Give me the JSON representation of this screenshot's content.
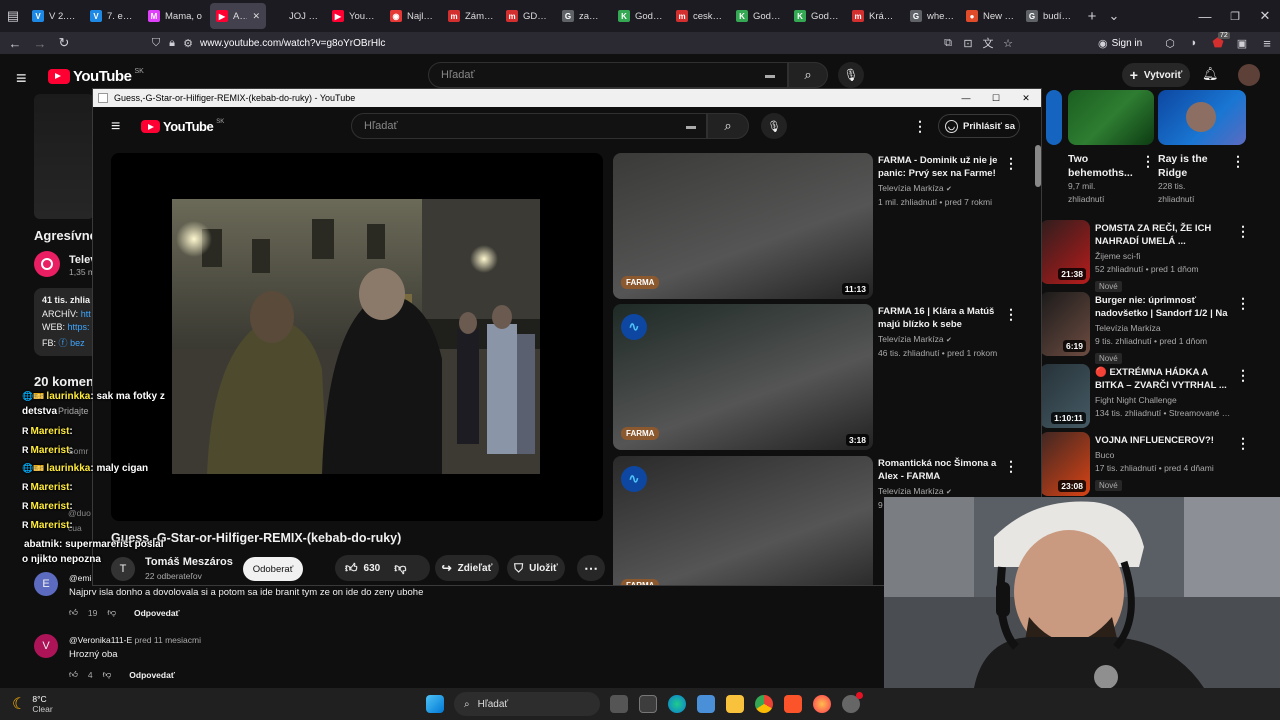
{
  "browser": {
    "tabs": [
      {
        "label": "V 2. epizó",
        "color": "#1e88e5",
        "glyph": "V"
      },
      {
        "label": "7. epizó",
        "color": "#1e88e5",
        "glyph": "V"
      },
      {
        "label": "Mama, o",
        "color": "#e040fb",
        "glyph": "M"
      },
      {
        "label": "Agres",
        "color": "#ff0033",
        "glyph": "▶",
        "active": true
      },
      {
        "label": "JOJ play",
        "color": "#1c1b22",
        "glyph": ""
      },
      {
        "label": "YouTube",
        "color": "#ff0033",
        "glyph": "▶"
      },
      {
        "label": "Najlepší",
        "color": "#e53935",
        "glyph": "◉"
      },
      {
        "label": "Zámena",
        "color": "#d32f2f",
        "glyph": "m"
      },
      {
        "label": "GDW6 -",
        "color": "#d32f2f",
        "glyph": "m"
      },
      {
        "label": "zamena",
        "color": "#5f6368",
        "glyph": "G"
      },
      {
        "label": "Godwin",
        "color": "#34a853",
        "glyph": "K"
      },
      {
        "label": "ceska re",
        "color": "#d32f2f",
        "glyph": "m"
      },
      {
        "label": "Godwin",
        "color": "#34a853",
        "glyph": "K"
      },
      {
        "label": "Godwin",
        "color": "#34a853",
        "glyph": "K"
      },
      {
        "label": "Krásne s",
        "color": "#d32f2f",
        "glyph": "m"
      },
      {
        "label": "where in",
        "color": "#5f6368",
        "glyph": "G"
      },
      {
        "label": "New Tab",
        "color": "#e04b2a",
        "glyph": "●"
      },
      {
        "label": "budík o",
        "color": "#5f6368",
        "glyph": "G"
      }
    ],
    "new_tab_glyph": "+",
    "url": "www.youtube.com/watch?v=g8oYrOBrHlc",
    "sign_in": "Sign in",
    "badge_count": "72"
  },
  "yt_bg": {
    "logo": "YouTube",
    "region": "SK",
    "search_placeholder": "Hľadať",
    "create": "Vytvoriť",
    "channel_title_partial": "Agresívne",
    "channel_name_partial": "Telev",
    "channel_subs_partial": "1,35 m",
    "desc_views_partial": "41 tis. zhlia",
    "desc_archiv": "ARCHÍV:",
    "desc_archiv_link": "htt",
    "desc_web": "WEB:",
    "desc_web_link": "https:",
    "desc_fb": "FB:",
    "desc_fb_link": "bez",
    "comments_heading_partial": "20 komen",
    "add_comment_partial": "Pridajte",
    "top_row": [
      {
        "title": "Two behemoths...",
        "meta1": "9,7 mil.",
        "meta2": "zhliadnutí"
      },
      {
        "title": "Ray is the Ridge",
        "meta1": "228 tis.",
        "meta2": "zhliadnutí"
      }
    ],
    "right_list": [
      {
        "title": "POMSTA ZA REČI, ŽE ICH NAHRADÍ UMELÁ ...",
        "channel": "Žijeme sci-fi",
        "meta": "52 zhliadnutí • pred 1 dňom",
        "badge": "Nové",
        "duration": "21:38"
      },
      {
        "title": "Burger nie: úprimnosť nadovšetko | Sandorf 1/2 | Na ...",
        "channel": "Televízia Markíza",
        "meta": "9 tis. zhliadnutí • pred 1 dňom",
        "badge": "Nové",
        "duration": "6:19"
      },
      {
        "title": "🔴 EXTRÉMNA HÁDKA A BITKA – ZVARČI VYTRHAL ...",
        "channel": "Fight Night Challenge",
        "meta": "134 tis. zhliadnutí • Streamované pred 4 ...",
        "badge": "",
        "duration": "1:10:11"
      },
      {
        "title": "VOJNA INFLUENCEROV?!",
        "channel": "Buco",
        "meta": "17 tis. zhliadnutí • pred 4 dňami",
        "badge": "Nové",
        "duration": "23:08"
      }
    ],
    "comments": [
      {
        "avatar": "E",
        "author": "@emi",
        "text": "Najprv isla donho a dovolovala si a potom sa ide branit tym ze on ide do zeny ubohe",
        "likes": "19",
        "reply": "Odpovedať",
        "avatar_color": "#5c6bc0"
      },
      {
        "avatar": "V",
        "author": "@Veronika111-E",
        "time": "pred 11 mesiacmi",
        "text": "Hrozný oba",
        "likes": "4",
        "reply": "Odpovedať",
        "avatar_color": "#ad1457"
      }
    ]
  },
  "popup": {
    "window_title": "Guess,-G-Star-or-Hilfiger-REMIX-(kebab-do-ruky) - YouTube",
    "logo": "YouTube",
    "region": "SK",
    "search_placeholder": "Hľadať",
    "sign_in": "Prihlásiť sa",
    "video_title": "Guess,-G-Star-or-Hilfiger-REMIX-(kebab-do-ruky)",
    "channel": "Tomáš Meszáros",
    "channel_initial": "T",
    "subscribers": "22 odberateľov",
    "subscribe": "Odoberať",
    "likes": "630",
    "share": "Zdieľať",
    "save": "Uložiť",
    "recommended": [
      {
        "title": "FARMA - Dominik už nie je panic: Prvý sex na Farme!",
        "channel": "Televízia Markíza",
        "meta": "1 mil. zhliadnutí • pred 7 rokmi",
        "duration": "11:13",
        "logo": "FARMA"
      },
      {
        "title": "FARMA 16 | Klára a Matúš majú blízko k sebe",
        "channel": "Televízia Markíza",
        "meta": "46 tis. zhliadnutí • pred 1 rokom",
        "duration": "3:18",
        "logo": "FARMA"
      },
      {
        "title": "Romantická noc Šimona a Alex - FARMA",
        "channel": "Televízia Markíza",
        "meta": "9",
        "duration": "",
        "logo": "FARMA"
      }
    ]
  },
  "chat": [
    {
      "user": "laurinkka",
      "text": ": sak ma fotky z detstva",
      "color": "#ffeb3b",
      "badges": "🌐🎫"
    },
    {
      "user": "Marerist",
      "text": ":",
      "color": "#ffeb3b",
      "badges": "R"
    },
    {
      "user": "Marerist",
      "text": ":",
      "color": "#ffeb3b",
      "badges": "R"
    },
    {
      "user": "laurinkka",
      "text": ": maly cigan",
      "color": "#ffeb3b",
      "badges": "🌐🎫"
    },
    {
      "user": "Marerist",
      "text": ":",
      "color": "#ffeb3b",
      "badges": "R"
    },
    {
      "user": "Marerist",
      "text": ":",
      "color": "#ffeb3b",
      "badges": "R"
    },
    {
      "user": "Marerist",
      "text": ":",
      "color": "#ffeb3b",
      "badges": "R"
    },
    {
      "user": "abatnik",
      "text": ": supermarerist poslal o njikto nepozna",
      "color": "#ffffff",
      "badges": ""
    }
  ],
  "chat_ghost": [
    "Somr",
    "@duo",
    "cua"
  ],
  "taskbar": {
    "temp": "8°C",
    "weather": "Clear",
    "search": "Hľadať"
  },
  "colors": {
    "yt_red": "#ff0033",
    "accent_blue": "#3ea6ff"
  }
}
